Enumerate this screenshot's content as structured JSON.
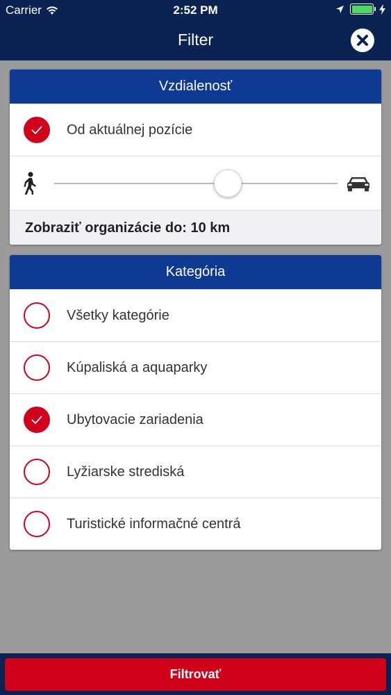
{
  "status_bar": {
    "carrier": "Carrier",
    "time": "2:52 PM"
  },
  "nav": {
    "title": "Filter",
    "close_icon": "close-circle-icon"
  },
  "distance_section": {
    "header": "Vzdialenosť",
    "current_position": {
      "label": "Od aktuálnej pozície",
      "checked": true
    },
    "slider": {
      "min_icon": "walking-person-icon",
      "max_icon": "car-icon",
      "value_fraction": 0.62
    },
    "summary": "Zobraziť organizácie do: 10 km"
  },
  "category_section": {
    "header": "Kategória",
    "items": [
      {
        "label": "Všetky kategórie",
        "checked": false
      },
      {
        "label": "Kúpaliská a aquaparky",
        "checked": false
      },
      {
        "label": "Ubytovacie zariadenia",
        "checked": true
      },
      {
        "label": "Lyžiarske strediská",
        "checked": false
      },
      {
        "label": "Turistické informačné centrá",
        "checked": false
      }
    ]
  },
  "footer": {
    "button_label": "Filtrovať"
  },
  "colors": {
    "navbar": "#0b2352",
    "section_header": "#0e3a93",
    "accent_red": "#d0021b",
    "battery": "#4cd964"
  }
}
